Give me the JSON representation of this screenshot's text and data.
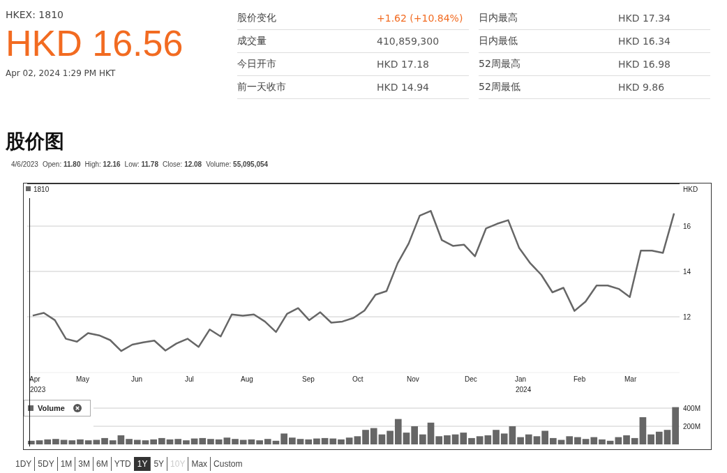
{
  "quote": {
    "exchange": "HKEX: 1810",
    "price": "HKD 16.56",
    "timestamp": "Apr 02, 2024 1:29 PM HKT"
  },
  "stats_columns": [
    [
      {
        "label": "股价变化",
        "value": "+1.62 (+10.84%)",
        "kind": "change"
      },
      {
        "label": "成交量",
        "value": "410,859,300",
        "kind": "plain"
      },
      {
        "label": "今日开市",
        "value": "HKD 17.18",
        "kind": "plain"
      },
      {
        "label": "前一天收市",
        "value": "HKD 14.94",
        "kind": "plain"
      }
    ],
    [
      {
        "label": "日内最高",
        "value": "HKD 17.34",
        "kind": "plain"
      },
      {
        "label": "日内最低",
        "value": "HKD 16.34",
        "kind": "plain"
      },
      {
        "label": "52周最高",
        "value": "HKD 16.98",
        "kind": "plain"
      },
      {
        "label": "52周最低",
        "value": "HKD 9.86",
        "kind": "plain"
      }
    ]
  ],
  "section_title": "股价图",
  "tooltip": {
    "date": "4/6/2023",
    "fields": [
      "Open: **11.80**",
      "High: **12.16**",
      "Low: **11.78**",
      "Close: **12.08**",
      "Volume: **55,095,054**"
    ]
  },
  "price_chart": {
    "unit": "HKD",
    "x_axis_labels": [
      {
        "label": "Apr",
        "year": "2023"
      },
      {
        "label": "May"
      },
      {
        "label": "Jun"
      },
      {
        "label": "Jul"
      },
      {
        "label": "Aug"
      },
      {
        "label": "Sep"
      },
      {
        "label": "Oct"
      },
      {
        "label": "Nov"
      },
      {
        "label": "Dec"
      },
      {
        "label": "Jan",
        "year": "2024"
      },
      {
        "label": "Feb"
      },
      {
        "label": "Mar"
      }
    ],
    "chart_data": {
      "type": "line",
      "grid": true,
      "ylim": [
        9.54,
        17.88
      ],
      "yticks": [
        12,
        14,
        16
      ],
      "series": [
        {
          "name": "1810",
          "color": "#666666",
          "values": [
            12.05,
            12.17,
            11.85,
            11.03,
            10.9,
            11.28,
            11.18,
            10.97,
            10.49,
            10.77,
            10.87,
            10.95,
            10.51,
            10.82,
            11.03,
            10.67,
            11.44,
            11.13,
            12.1,
            12.05,
            12.1,
            11.79,
            11.33,
            12.13,
            12.38,
            11.85,
            12.2,
            11.74,
            11.79,
            11.95,
            12.27,
            12.97,
            13.13,
            14.36,
            15.23,
            16.46,
            16.67,
            15.38,
            15.13,
            15.18,
            14.67,
            15.9,
            16.1,
            16.26,
            15.03,
            14.36,
            13.85,
            13.08,
            13.28,
            12.26,
            12.67,
            13.38,
            13.38,
            13.23,
            12.87,
            14.92,
            14.92,
            14.82,
            16.56
          ]
        }
      ]
    }
  },
  "volume_chart": {
    "chart_data": {
      "type": "bar",
      "ylim": [
        0,
        411
      ],
      "yticks": [
        {
          "value": 200,
          "label": "200M"
        },
        {
          "value": 400,
          "label": "400M"
        }
      ],
      "series": [
        {
          "name": "Volume",
          "color": "#666666",
          "values": [
            40,
            45,
            55,
            60,
            50,
            45,
            55,
            45,
            50,
            70,
            45,
            100,
            60,
            50,
            45,
            55,
            70,
            55,
            60,
            45,
            65,
            70,
            60,
            55,
            75,
            60,
            50,
            55,
            45,
            60,
            40,
            120,
            75,
            60,
            55,
            65,
            70,
            65,
            55,
            75,
            90,
            160,
            180,
            110,
            150,
            280,
            130,
            200,
            110,
            240,
            90,
            100,
            110,
            130,
            70,
            90,
            100,
            160,
            120,
            200,
            80,
            110,
            90,
            150,
            70,
            50,
            90,
            80,
            60,
            80,
            55,
            40,
            80,
            100,
            70,
            300,
            110,
            140,
            160,
            411
          ]
        }
      ]
    }
  },
  "ranges": [
    {
      "label": "1DY",
      "selected": false,
      "disabled": false
    },
    {
      "label": "5DY",
      "selected": false,
      "disabled": false
    },
    {
      "label": "1M",
      "selected": false,
      "disabled": false
    },
    {
      "label": "3M",
      "selected": false,
      "disabled": false
    },
    {
      "label": "6M",
      "selected": false,
      "disabled": false
    },
    {
      "label": "YTD",
      "selected": false,
      "disabled": false
    },
    {
      "label": "1Y",
      "selected": true,
      "disabled": false
    },
    {
      "label": "5Y",
      "selected": false,
      "disabled": false
    },
    {
      "label": "10Y",
      "selected": false,
      "disabled": true
    },
    {
      "label": "Max",
      "selected": false,
      "disabled": false
    },
    {
      "label": "Custom",
      "selected": false,
      "disabled": false
    }
  ]
}
